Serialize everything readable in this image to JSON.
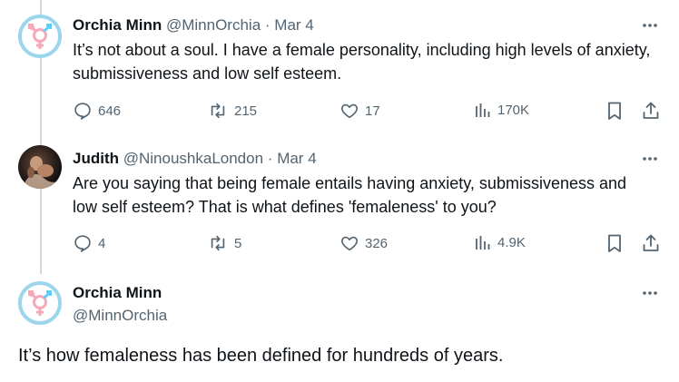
{
  "tweets": [
    {
      "display_name": "Orchia Minn",
      "handle": "@MinnOrchia",
      "separator": "·",
      "date": "Mar 4",
      "text": "It’s not about a soul.  I have a female personality, including high levels of anxiety, submissiveness and low self esteem.",
      "replies": "646",
      "reposts": "215",
      "likes": "17",
      "views": "170K"
    },
    {
      "display_name": "Judith",
      "handle": "@NinoushkaLondon",
      "separator": "·",
      "date": "Mar 4",
      "text": "Are you saying that being female entails having anxiety, submissiveness and low self esteem? That is what defines 'femaleness' to you?",
      "replies": "4",
      "reposts": "5",
      "likes": "326",
      "views": "4.9K"
    }
  ],
  "focused": {
    "display_name": "Orchia Minn",
    "handle": "@MinnOrchia",
    "text": "It’s how femaleness has been defined for hundreds of years."
  },
  "icons": {
    "avatar_orchia": "transgender-symbol-icon",
    "more": "more-horizontal-icon",
    "reply": "reply-icon",
    "repost": "repost-icon",
    "like": "heart-icon",
    "views": "views-bar-chart-icon",
    "bookmark": "bookmark-icon",
    "share": "share-icon"
  },
  "colors": {
    "accent_pink": "#f5a9b8",
    "accent_blue": "#5bcefa",
    "muted_text": "#536471",
    "thread_line": "#cfd9de"
  }
}
